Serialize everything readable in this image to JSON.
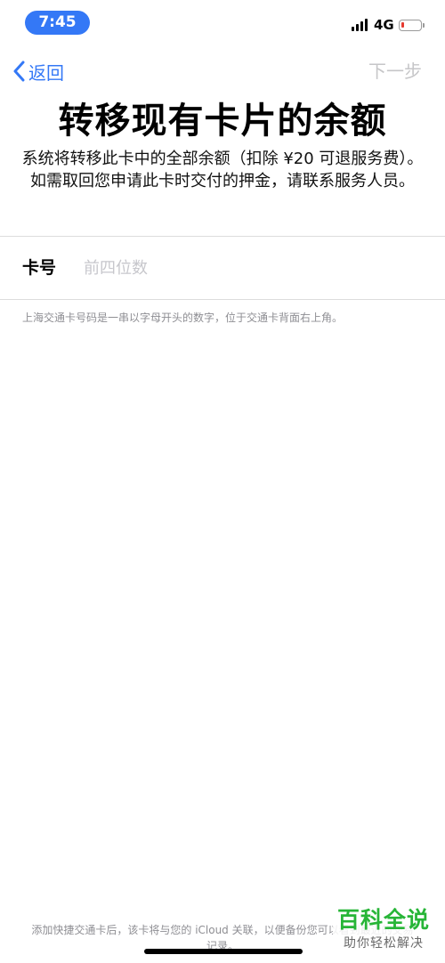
{
  "status_bar": {
    "time": "7:45",
    "network": "4G",
    "battery_level": 0.15,
    "battery_color": "#e53a30"
  },
  "nav": {
    "back_label": "返回",
    "next_label": "下一步",
    "accent_color": "#3478f6"
  },
  "title": "转移现有卡片的余额",
  "description": "系统将转移此卡中的全部余额（扣除 ¥20 可退服务费）。如需取回您申请此卡时交付的押金，请联系服务人员。",
  "card_field": {
    "label": "卡号",
    "placeholder": "前四位数",
    "value": ""
  },
  "hint": "上海交通卡号码是一串以字母开头的数字，位于交通卡背面右上角。",
  "footer": "添加快捷交通卡后，该卡将与您的 iCloud 关联，以便备份您可以看到最近的交易记录。",
  "watermark": {
    "title": "百科全说",
    "subtitle": "助你轻松解决"
  }
}
